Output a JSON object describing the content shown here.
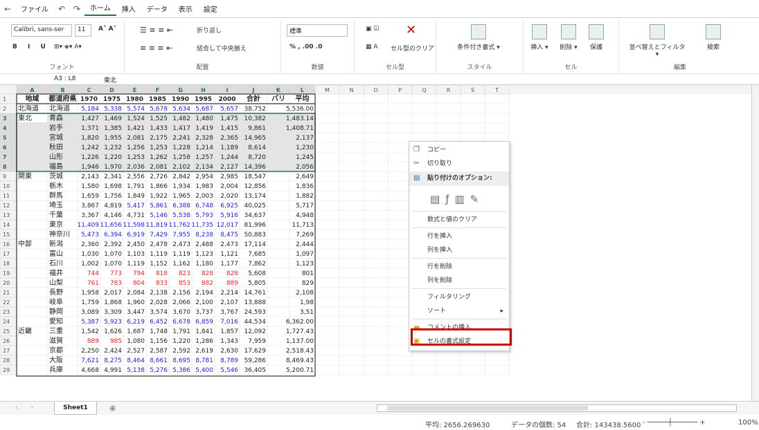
{
  "menu": {
    "tabs": [
      "ファイル",
      "ホーム",
      "挿入",
      "データ",
      "表示",
      "設定"
    ],
    "active": "ホーム"
  },
  "ribbon": {
    "font_name": "Calibri, sans-ser",
    "font_size": "11",
    "wrap_text": "折り返し",
    "merge_center": "結合して中央揃え",
    "number_format": "標準",
    "cell_clear": "セル型のクリア",
    "conditional_format": "条件付き書式",
    "insert": "挿入",
    "delete": "削除",
    "protect": "保護",
    "sort_filter": "並べ替えとフィルタ",
    "find": "検索",
    "groups": {
      "font": "フォント",
      "alignment": "配置",
      "number": "数値",
      "cell_type": "セル型",
      "style": "スタイル",
      "cells": "セル",
      "editing": "編集"
    }
  },
  "formula_bar": {
    "name_box": "A3 : L8",
    "value": "東北"
  },
  "sheet": {
    "columns": [
      "A",
      "B",
      "C",
      "D",
      "E",
      "F",
      "G",
      "H",
      "I",
      "J",
      "K",
      "L",
      "M",
      "N",
      "O",
      "P",
      "Q",
      "R",
      "S",
      "T"
    ],
    "headers": [
      "地域",
      "都道府県",
      "1970",
      "1975",
      "1980",
      "1985",
      "1990",
      "1995",
      "2000",
      "合計",
      "バリ",
      "平均"
    ],
    "row_numbers": [
      1,
      2,
      3,
      4,
      5,
      6,
      7,
      8,
      9,
      10,
      11,
      12,
      13,
      14,
      15,
      16,
      17,
      18,
      19,
      20,
      21,
      22,
      23,
      24,
      25,
      26,
      27,
      28,
      29
    ],
    "regions": {
      "2": "北海道",
      "3": "東北",
      "9": "関東",
      "16": "中部",
      "25": "近畿"
    },
    "rows": [
      {
        "pref": "北海道",
        "vals": [
          "5,184",
          "5,338",
          "5,574",
          "5,678",
          "5,634",
          "5,687",
          "5,657"
        ],
        "sum": "38,752",
        "avg": "5,536.00",
        "color": "blue"
      },
      {
        "pref": "青森",
        "vals": [
          "1,427",
          "1,469",
          "1,524",
          "1,525",
          "1,482",
          "1,480",
          "1,475"
        ],
        "sum": "10,382",
        "avg": "1,483.14",
        "color": "black"
      },
      {
        "pref": "岩手",
        "vals": [
          "1,371",
          "1,385",
          "1,421",
          "1,433",
          "1,417",
          "1,419",
          "1,415"
        ],
        "sum": "9,861",
        "avg": "1,408.71",
        "color": "black"
      },
      {
        "pref": "宮城",
        "vals": [
          "1,820",
          "1,955",
          "2,081",
          "2,175",
          "2,241",
          "2,328",
          "2,365"
        ],
        "sum": "14,965",
        "avg": "2,137",
        "color": "black"
      },
      {
        "pref": "秋田",
        "vals": [
          "1,242",
          "1,232",
          "1,256",
          "1,253",
          "1,228",
          "1,214",
          "1,189"
        ],
        "sum": "8,614",
        "avg": "1,230",
        "color": "black"
      },
      {
        "pref": "山形",
        "vals": [
          "1,226",
          "1,220",
          "1,253",
          "1,262",
          "1,258",
          "1,257",
          "1,244"
        ],
        "sum": "8,720",
        "avg": "1,245",
        "color": "black"
      },
      {
        "pref": "福島",
        "vals": [
          "1,946",
          "1,970",
          "2,036",
          "2,081",
          "2,102",
          "2,134",
          "2,127"
        ],
        "sum": "14,396",
        "avg": "2,056",
        "color": "black"
      },
      {
        "pref": "茨城",
        "vals": [
          "2,143",
          "2,341",
          "2,556",
          "2,726",
          "2,842",
          "2,954",
          "2,985"
        ],
        "sum": "18,547",
        "avg": "2,649",
        "color": "black"
      },
      {
        "pref": "栃木",
        "vals": [
          "1,580",
          "1,698",
          "1,791",
          "1,866",
          "1,934",
          "1,983",
          "2,004"
        ],
        "sum": "12,856",
        "avg": "1,836",
        "color": "black"
      },
      {
        "pref": "群馬",
        "vals": [
          "1,659",
          "1,756",
          "1,849",
          "1,922",
          "1,965",
          "2,003",
          "2,020"
        ],
        "sum": "13,174",
        "avg": "1,882",
        "color": "black"
      },
      {
        "pref": "埼玉",
        "vals": [
          "3,867",
          "4,819",
          "5,417",
          "5,861",
          "6,388",
          "6,748",
          "6,925"
        ],
        "sum": "40,025",
        "avg": "5,717",
        "color": "mixed"
      },
      {
        "pref": "千葉",
        "vals": [
          "3,367",
          "4,146",
          "4,731",
          "5,146",
          "5,538",
          "5,793",
          "5,916"
        ],
        "sum": "34,637",
        "avg": "4,948",
        "color": "mixed2"
      },
      {
        "pref": "東京",
        "vals": [
          "11,409",
          "11,656",
          "11,598",
          "11,819",
          "11,762",
          "11,735",
          "12,017"
        ],
        "sum": "81,996",
        "avg": "11,713",
        "color": "blue"
      },
      {
        "pref": "神奈川",
        "vals": [
          "5,473",
          "6,394",
          "6,919",
          "7,429",
          "7,955",
          "8,238",
          "8,475"
        ],
        "sum": "50,883",
        "avg": "7,269",
        "color": "blue"
      },
      {
        "pref": "新潟",
        "vals": [
          "2,360",
          "2,392",
          "2,450",
          "2,478",
          "2,473",
          "2,488",
          "2,473"
        ],
        "sum": "17,114",
        "avg": "2,444",
        "color": "black"
      },
      {
        "pref": "富山",
        "vals": [
          "1,030",
          "1,070",
          "1,103",
          "1,119",
          "1,119",
          "1,123",
          "1,121"
        ],
        "sum": "7,685",
        "avg": "1,097",
        "color": "black"
      },
      {
        "pref": "石川",
        "vals": [
          "1,002",
          "1,070",
          "1,119",
          "1,152",
          "1,162",
          "1,180",
          "1,177"
        ],
        "sum": "7,862",
        "avg": "1,123",
        "color": "black"
      },
      {
        "pref": "福井",
        "vals": [
          "744",
          "773",
          "794",
          "818",
          "823",
          "828",
          "828"
        ],
        "sum": "5,608",
        "avg": "801",
        "color": "red"
      },
      {
        "pref": "山梨",
        "vals": [
          "761",
          "783",
          "804",
          "833",
          "853",
          "882",
          "889"
        ],
        "sum": "5,805",
        "avg": "829",
        "color": "red"
      },
      {
        "pref": "長野",
        "vals": [
          "1,958",
          "2,017",
          "2,084",
          "2,138",
          "2,156",
          "2,194",
          "2,214"
        ],
        "sum": "14,761",
        "avg": "2,108",
        "color": "black"
      },
      {
        "pref": "岐阜",
        "vals": [
          "1,759",
          "1,868",
          "1,960",
          "2,028",
          "2,066",
          "2,100",
          "2,107"
        ],
        "sum": "13,888",
        "avg": "1,98",
        "color": "black"
      },
      {
        "pref": "静岡",
        "vals": [
          "3,089",
          "3,309",
          "3,447",
          "3,574",
          "3,670",
          "3,737",
          "3,767"
        ],
        "sum": "24,593",
        "avg": "3,51",
        "color": "black"
      },
      {
        "pref": "愛知",
        "vals": [
          "5,387",
          "5,923",
          "6,219",
          "6,452",
          "6,678",
          "6,859",
          "7,016"
        ],
        "sum": "44,534",
        "avg": "6,362.00",
        "color": "blue"
      },
      {
        "pref": "三重",
        "vals": [
          "1,542",
          "1,626",
          "1,687",
          "1,748",
          "1,791",
          "1,841",
          "1,857"
        ],
        "sum": "12,092",
        "avg": "1,727.43",
        "color": "black"
      },
      {
        "pref": "滋賀",
        "vals": [
          "889",
          "985",
          "1,080",
          "1,156",
          "1,220",
          "1,286",
          "1,343"
        ],
        "sum": "7,959",
        "avg": "1,137.00",
        "color": "mixred"
      },
      {
        "pref": "京都",
        "vals": [
          "2,250",
          "2,424",
          "2,527",
          "2,587",
          "2,592",
          "2,619",
          "2,630"
        ],
        "sum": "17,629",
        "avg": "2,518.43",
        "color": "black"
      },
      {
        "pref": "大阪",
        "vals": [
          "7,621",
          "8,275",
          "8,464",
          "8,661",
          "8,695",
          "8,781",
          "8,789"
        ],
        "sum": "59,286",
        "avg": "8,469.43",
        "color": "blue"
      },
      {
        "pref": "兵庫",
        "vals": [
          "4,668",
          "4,991",
          "5,138",
          "5,276",
          "5,386",
          "5,400",
          "5,546"
        ],
        "sum": "36,405",
        "avg": "5,200.71",
        "color": "mixed3"
      }
    ]
  },
  "context_menu": {
    "copy": "コピー",
    "cut": "切り取り",
    "paste_options": "貼り付けのオプション:",
    "clear_formula_value": "数式と値のクリア",
    "insert_row": "行を挿入",
    "insert_col": "列を挿入",
    "delete_row": "行を削除",
    "delete_col": "列を削除",
    "filtering": "フィルタリング",
    "sort": "ソート",
    "insert_comment": "コメントの挿入",
    "format_cells": "セルの書式設定"
  },
  "sheet_tab": "Sheet1",
  "status": {
    "average": "平均: 2656.269630",
    "count": "データの個数: 54",
    "sum": "合計: 143438.5600",
    "zoom": "100%"
  },
  "colors": {
    "accent": "#217346",
    "blue": "#1a1aff",
    "red": "#ff2020",
    "highlight": "#d00000"
  }
}
